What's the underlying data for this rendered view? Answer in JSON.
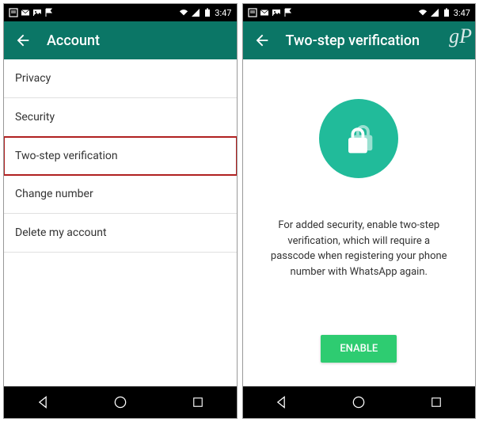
{
  "status": {
    "time": "3:47"
  },
  "left": {
    "title": "Account",
    "items": [
      {
        "label": "Privacy"
      },
      {
        "label": "Security"
      },
      {
        "label": "Two-step verification",
        "highlighted": true
      },
      {
        "label": "Change number"
      },
      {
        "label": "Delete my account"
      }
    ]
  },
  "right": {
    "title": "Two-step verification",
    "body": "For added security, enable two-step verification, which will require a passcode when registering your phone number with WhatsApp again.",
    "enable_label": "ENABLE",
    "watermark": "gP"
  }
}
